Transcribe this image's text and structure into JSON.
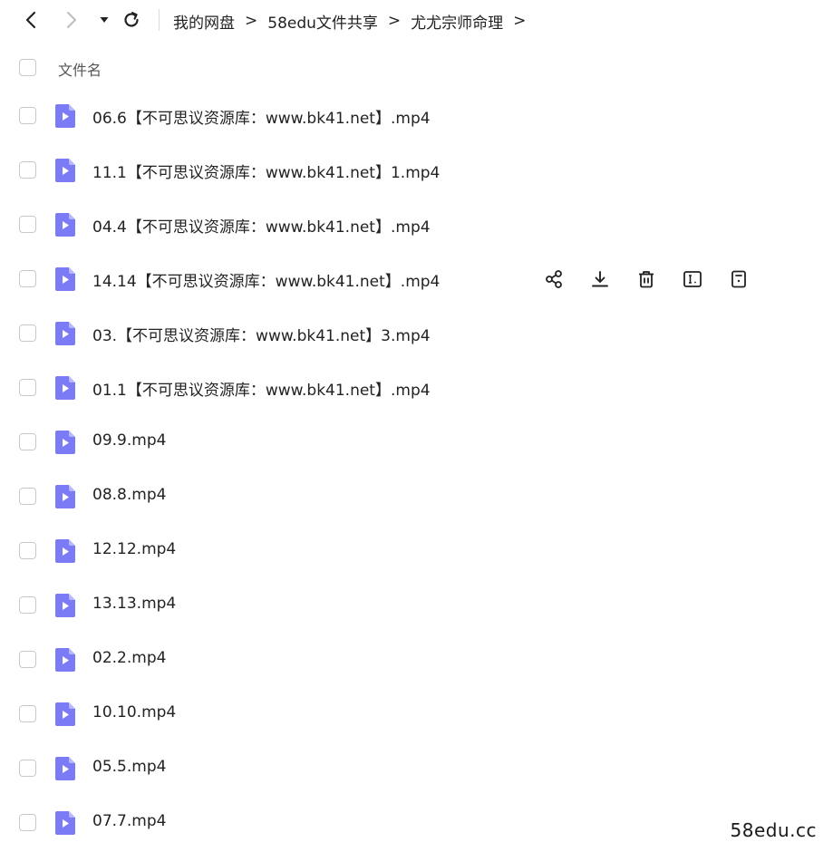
{
  "toolbar": {
    "back_icon": "chevron-left-icon",
    "forward_icon": "chevron-right-icon",
    "history_icon": "caret-down-icon",
    "refresh_icon": "refresh-icon"
  },
  "breadcrumb": {
    "items": [
      "我的网盘",
      "58edu文件共享",
      "尤尤宗师命理"
    ],
    "separator": ">"
  },
  "header": {
    "column_label": "文件名"
  },
  "files": [
    {
      "name": "06.6【不可思议资源库：www.bk41.net】.mp4"
    },
    {
      "name": "11.1【不可思议资源库：www.bk41.net】1.mp4"
    },
    {
      "name": "04.4【不可思议资源库：www.bk41.net】.mp4"
    },
    {
      "name": "14.14【不可思议资源库：www.bk41.net】.mp4"
    },
    {
      "name": "03.【不可思议资源库：www.bk41.net】3.mp4"
    },
    {
      "name": "01.1【不可思议资源库：www.bk41.net】.mp4"
    },
    {
      "name": "09.9.mp4"
    },
    {
      "name": "08.8.mp4"
    },
    {
      "name": "12.12.mp4"
    },
    {
      "name": "13.13.mp4"
    },
    {
      "name": "02.2.mp4"
    },
    {
      "name": "10.10.mp4"
    },
    {
      "name": "05.5.mp4"
    },
    {
      "name": "07.7.mp4"
    }
  ],
  "row_actions": {
    "hovered_row_index": 3,
    "icons": [
      "share-icon",
      "download-icon",
      "delete-icon",
      "rename-icon",
      "details-icon"
    ]
  },
  "watermark": "58edu.cc",
  "colors": {
    "file_icon": "#7b7cf5",
    "file_icon_fold": "#b7b8fb"
  }
}
